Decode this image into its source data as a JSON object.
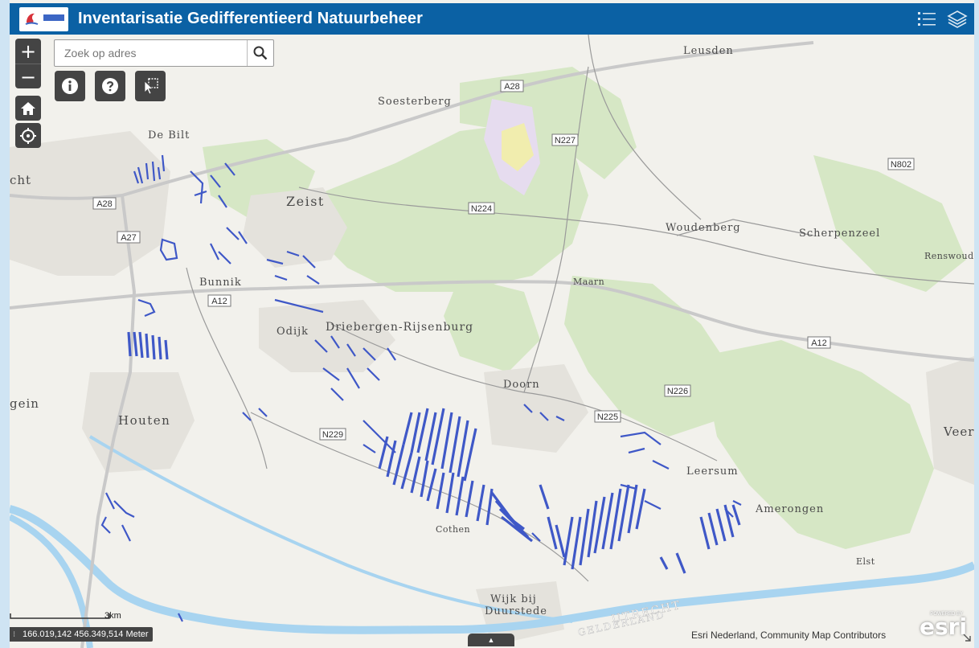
{
  "app": {
    "title": "Inventarisatie Gedifferentieerd Natuurbeheer"
  },
  "header": {
    "legend_icon": "legend-list-icon",
    "layers_icon": "layers-stack-icon"
  },
  "controls": {
    "zoom_in": "+",
    "zoom_out": "−",
    "search_placeholder": "Zoek op adres",
    "search_icon": "magnifier-icon",
    "info_icon": "info-icon",
    "help_icon": "question-icon",
    "select_icon": "pointer-select-icon",
    "home_icon": "home-icon",
    "locate_icon": "locate-icon"
  },
  "map": {
    "places": {
      "leusden": "Leusden",
      "soesterberg": "Soesterberg",
      "de_bilt": "De Bilt",
      "zeist": "Zeist",
      "utrecht_partial": "cht",
      "woudenberg": "Woudenberg",
      "scherpenzeel": "Scherpenzeel",
      "renswoude": "Renswoud",
      "bunnik": "Bunnik",
      "maarn": "Maarn",
      "odijk": "Odijk",
      "driebergen": "Driebergen-Rijsenburg",
      "doorn": "Doorn",
      "nieuwegein_partial": "gein",
      "houten": "Houten",
      "leersum": "Leersum",
      "veenendaal_partial": "Veer",
      "amerongen": "Amerongen",
      "cothen": "Cothen",
      "elst": "Elst",
      "wijk_line1": "Wijk bij",
      "wijk_line2": "Duurstede",
      "utrecht_region": "UTRECHT",
      "gelderland_region": "GELDERLAND"
    },
    "roads": {
      "a28_north": "A28",
      "n227": "N227",
      "n802": "N802",
      "a28_west": "A28",
      "n224": "N224",
      "a27": "A27",
      "a12_west": "A12",
      "a12_east": "A12",
      "n226": "N226",
      "n225": "N225",
      "n229": "N229"
    },
    "layer_color": "#3f58c7",
    "water_color": "#a8d4f0",
    "forest_color": "#d4e6c3"
  },
  "footer": {
    "coordinates": "166.019,142 456.349,514 Meter",
    "scale_label": "3km",
    "attribution": "Esri Nederland, Community Map Contributors",
    "esri_powered": "POWERED BY",
    "esri_logo": "esri"
  }
}
